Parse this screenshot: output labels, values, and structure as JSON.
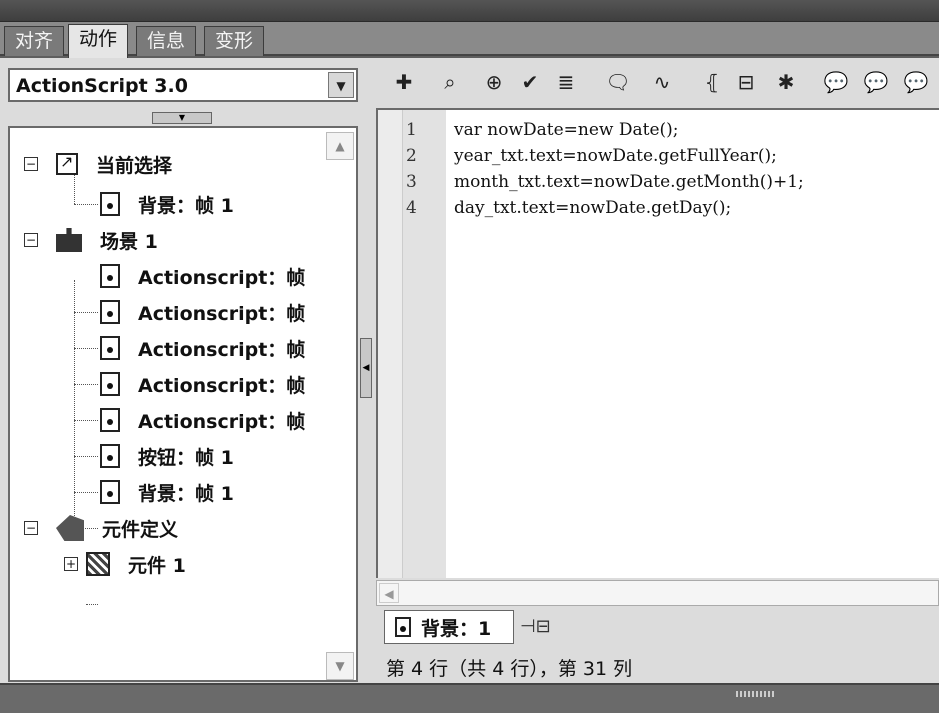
{
  "tabs": [
    "对齐",
    "动作",
    "信息",
    "变形"
  ],
  "active_tab": "动作",
  "language_select": {
    "value": "ActionScript 3.0"
  },
  "tree": {
    "current_selection": "当前选择",
    "current_frame": "背景：帧 1",
    "scene": "场景 1",
    "scene_items": [
      "Actionscript：帧",
      "Actionscript：帧",
      "Actionscript：帧",
      "Actionscript：帧",
      "Actionscript：帧",
      "按钮：帧 1",
      "背景：帧 1"
    ],
    "symbol_definitions": "元件定义",
    "symbol_item": "元件 1"
  },
  "toolbar_icons": [
    "add-statement-icon",
    "find-icon",
    "target-icon",
    "check-syntax-icon",
    "auto-format-icon",
    "code-hint-icon",
    "debug-options-icon",
    "collapse-braces-icon",
    "collapse-selection-icon",
    "expand-all-icon",
    "comment-block-icon",
    "comment-line-icon",
    "uncomment-icon"
  ],
  "code": {
    "line_numbers": [
      "1",
      "2",
      "3",
      "4"
    ],
    "lines": [
      "var nowDate=new Date();",
      "year_txt.text=nowDate.getFullYear();",
      "month_txt.text=nowDate.getMonth()+1;",
      "day_txt.text=nowDate.getDay();"
    ]
  },
  "frame_tab": "背景：1",
  "status": "第 4 行（共 4 行），第 31 列"
}
